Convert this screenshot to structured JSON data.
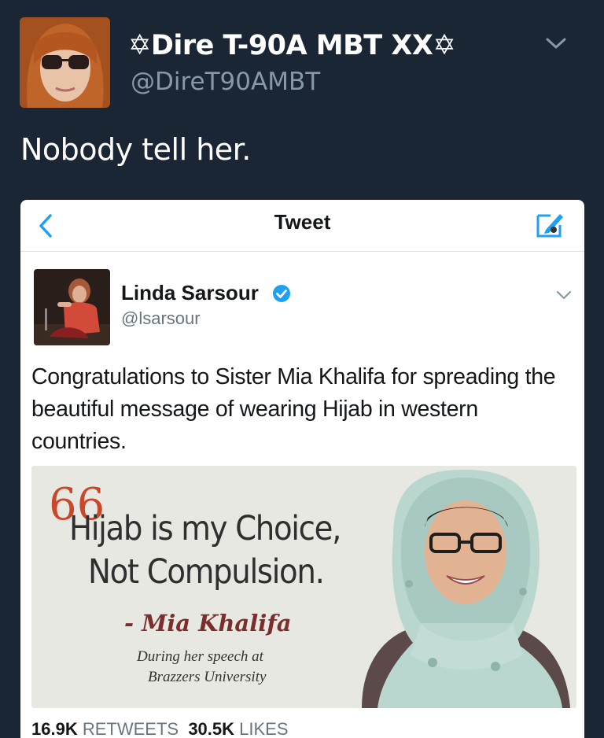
{
  "outer_tweet": {
    "display_name": "✡Dire T-90A MBT XX✡",
    "handle": "@DireT90AMBT",
    "text": "Nobody tell her.",
    "avatar_icon": "user-avatar-sunglasses"
  },
  "embedded_screenshot": {
    "header_title": "Tweet",
    "back_icon": "chevron-left-icon",
    "compose_icon": "compose-tweet-icon",
    "tweet": {
      "display_name": "Linda Sarsour",
      "verified": true,
      "handle": "@lsarsour",
      "text": "Congratulations to Sister Mia Khalifa for spreading the beautiful message of wearing Hijab in western countries.",
      "media": {
        "quote_mark": "66",
        "quote_line1": "Hijab is my Choice,",
        "quote_line2": "Not Compulsion.",
        "author": "- Mia Khalifa",
        "caption_line1": "During her speech at",
        "caption_line2": "Brazzers University"
      },
      "retweets_count": "16.9K",
      "retweets_label": "RETWEETS",
      "likes_count": "30.5K",
      "likes_label": "LIKES"
    }
  },
  "colors": {
    "background": "#1b2634",
    "accent_blue": "#1da1f2",
    "muted_text": "#8899a6"
  }
}
